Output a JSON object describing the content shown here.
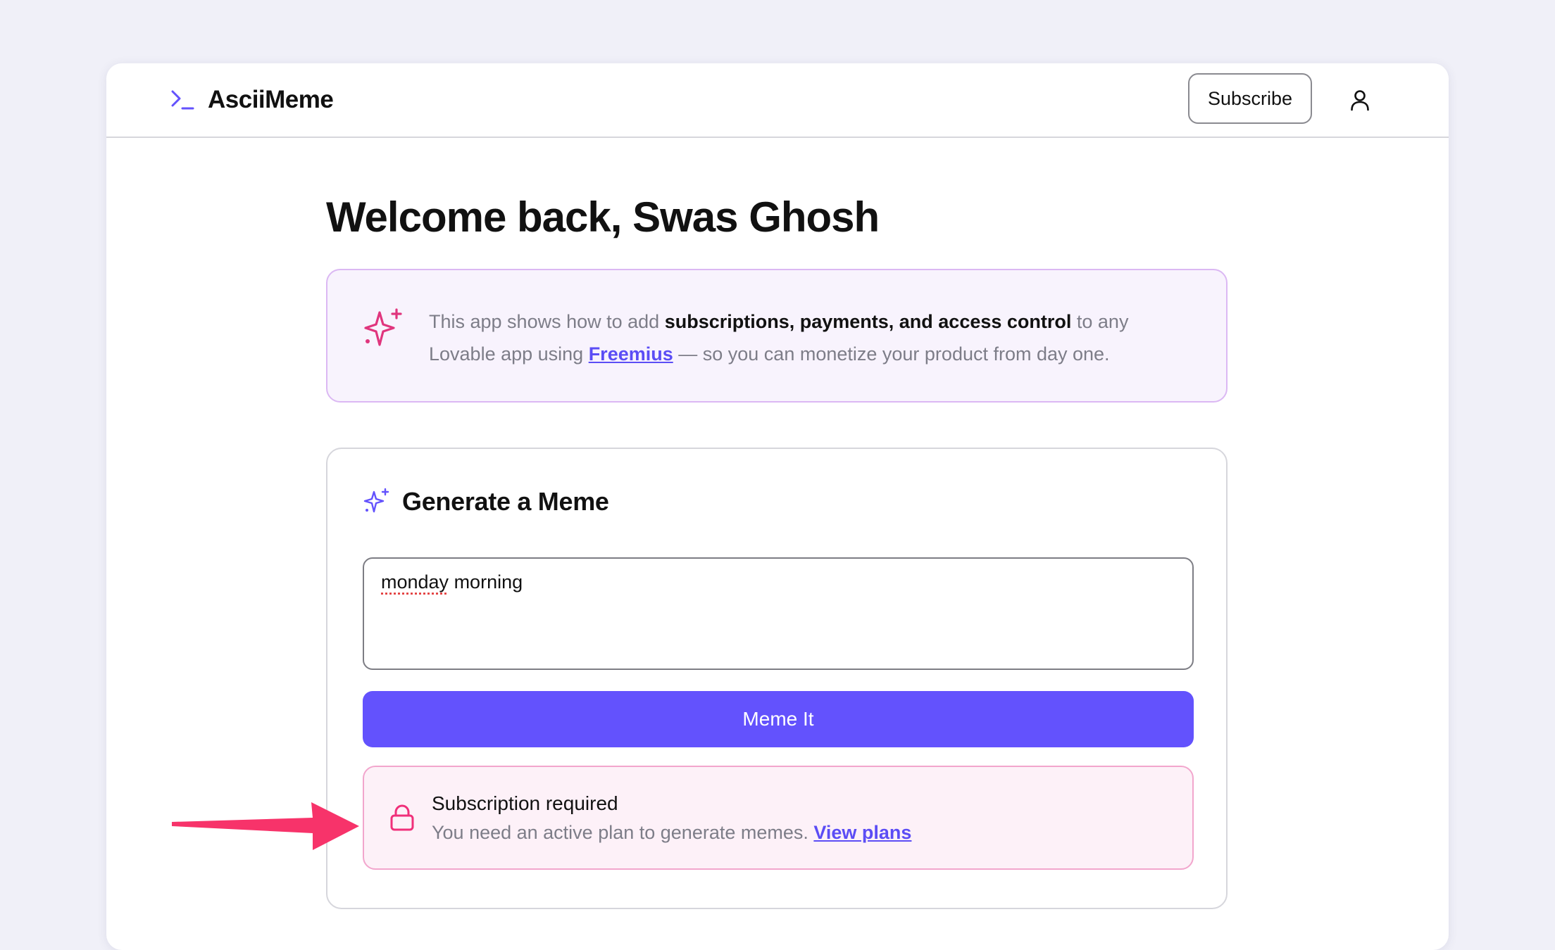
{
  "app": {
    "name": "AsciiMeme",
    "logo_icon": "terminal-prompt-icon",
    "accent_color": "#6352fd"
  },
  "header": {
    "subscribe_label": "Subscribe",
    "user_icon": "user-icon"
  },
  "page": {
    "title": "Welcome back, Swas Ghosh"
  },
  "info_banner": {
    "icon": "sparkle-icon",
    "text_before": "This app shows how to add ",
    "text_bold": "subscriptions, payments, and access control",
    "text_middle": " to any Lovable app using ",
    "link_label": "Freemius",
    "text_after": " — so you can monetize your product from day one."
  },
  "generator": {
    "icon": "sparkle-icon",
    "title": "Generate a Meme",
    "prompt_word_1": "monday",
    "prompt_word_2": " morning",
    "button_label": "Meme It"
  },
  "alert": {
    "icon": "lock-icon",
    "title": "Subscription required",
    "message": "You need an active plan to generate memes. ",
    "link_label": "View plans",
    "color": "#f0307a"
  },
  "annotation": {
    "icon": "arrow-right-icon",
    "color": "#f7336a"
  }
}
